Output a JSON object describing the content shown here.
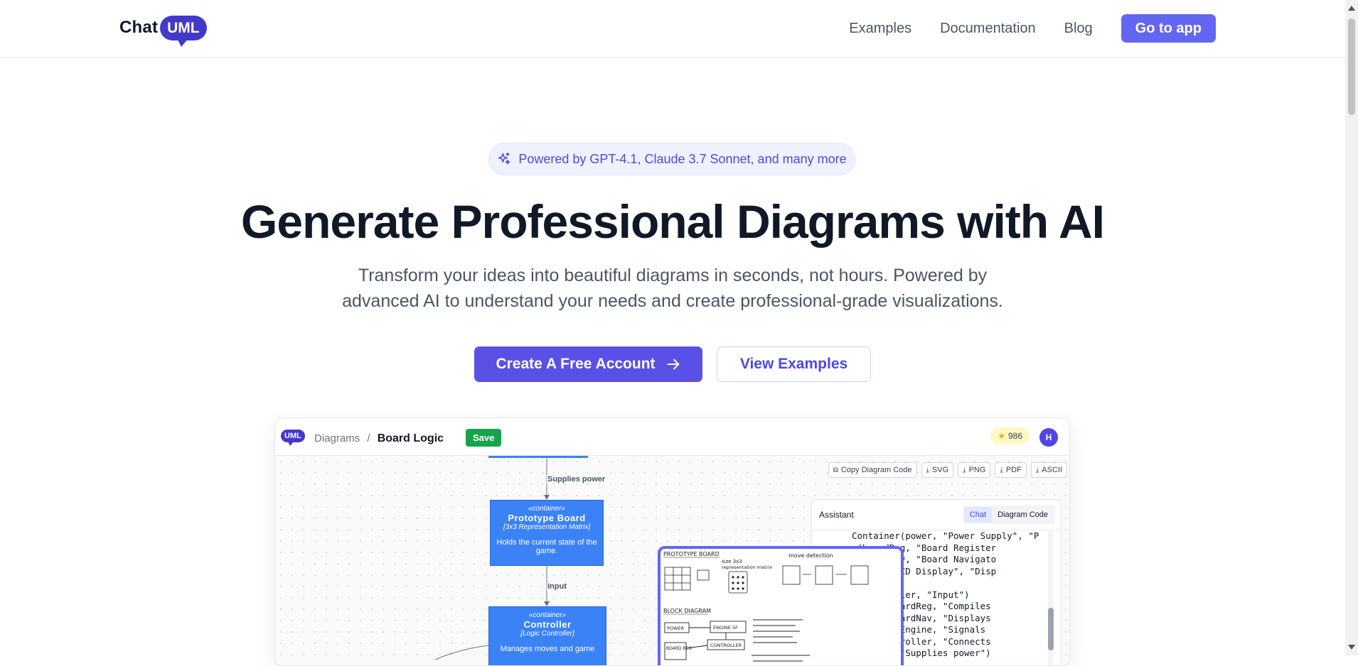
{
  "header": {
    "logo_text": "Chat",
    "logo_badge": "UML",
    "nav": [
      "Examples",
      "Documentation",
      "Blog"
    ],
    "cta": "Go to app"
  },
  "hero": {
    "badge": "Powered by GPT-4.1, Claude 3.7 Sonnet, and many more",
    "headline": "Generate Professional Diagrams with AI",
    "subtitle_line1": "Transform your ideas into beautiful diagrams in seconds, not hours. Powered by",
    "subtitle_line2": "advanced AI to understand your needs and create professional-grade visualizations.",
    "primary_button": "Create A Free Account",
    "secondary_button": "View Examples"
  },
  "preview": {
    "logo": "UML",
    "breadcrumb_root": "Diagrams",
    "breadcrumb_sep": "/",
    "breadcrumb_current": "Board Logic",
    "save": "Save",
    "credits": "986",
    "avatar": "H",
    "toolbar": [
      "Copy Diagram Code",
      "SVG",
      "PNG",
      "PDF",
      "ASCII"
    ],
    "edges": {
      "supplies_power": "Supplies power",
      "input": "Input"
    },
    "nodes": {
      "board": {
        "stereotype": "«container»",
        "name": "Prototype Board",
        "type": "[3x3 Representation Matrix]",
        "desc": "Holds the current state of the game."
      },
      "controller": {
        "stereotype": "«container»",
        "name": "Controller",
        "type": "[Logic Controller]",
        "desc": "Manages moves and game"
      }
    },
    "sketch": {
      "title1": "PROTOTYPE BOARD",
      "note_size": "size 3x3",
      "note_repr": "representation matrix",
      "note_move": "move detection",
      "title2": "BLOCK DIAGRAM",
      "blocks": [
        "POWER",
        "ENGINE SF",
        "CONTROLLER",
        "BOARD REG"
      ]
    },
    "assistant": {
      "title": "Assistant",
      "tabs": [
        "Chat",
        "Diagram Code"
      ],
      "code_lines": [
        "Container(power, \"Power Supply\", \"P",
        "r(boardReg, \"Board Register",
        "r(boardNav, \"Board Navigato",
        "r(lcd, \"LCD Display\", \"Disp",
        "",
        ", controller, \"Input\")",
        "oller, boardReg, \"Compiles",
        "oller, boardNav, \"Displays",
        "oller, sfEngine, \"Signals",
        "ine, controller, \"Connects",
        ", board, \"Supplies power\")"
      ]
    }
  }
}
